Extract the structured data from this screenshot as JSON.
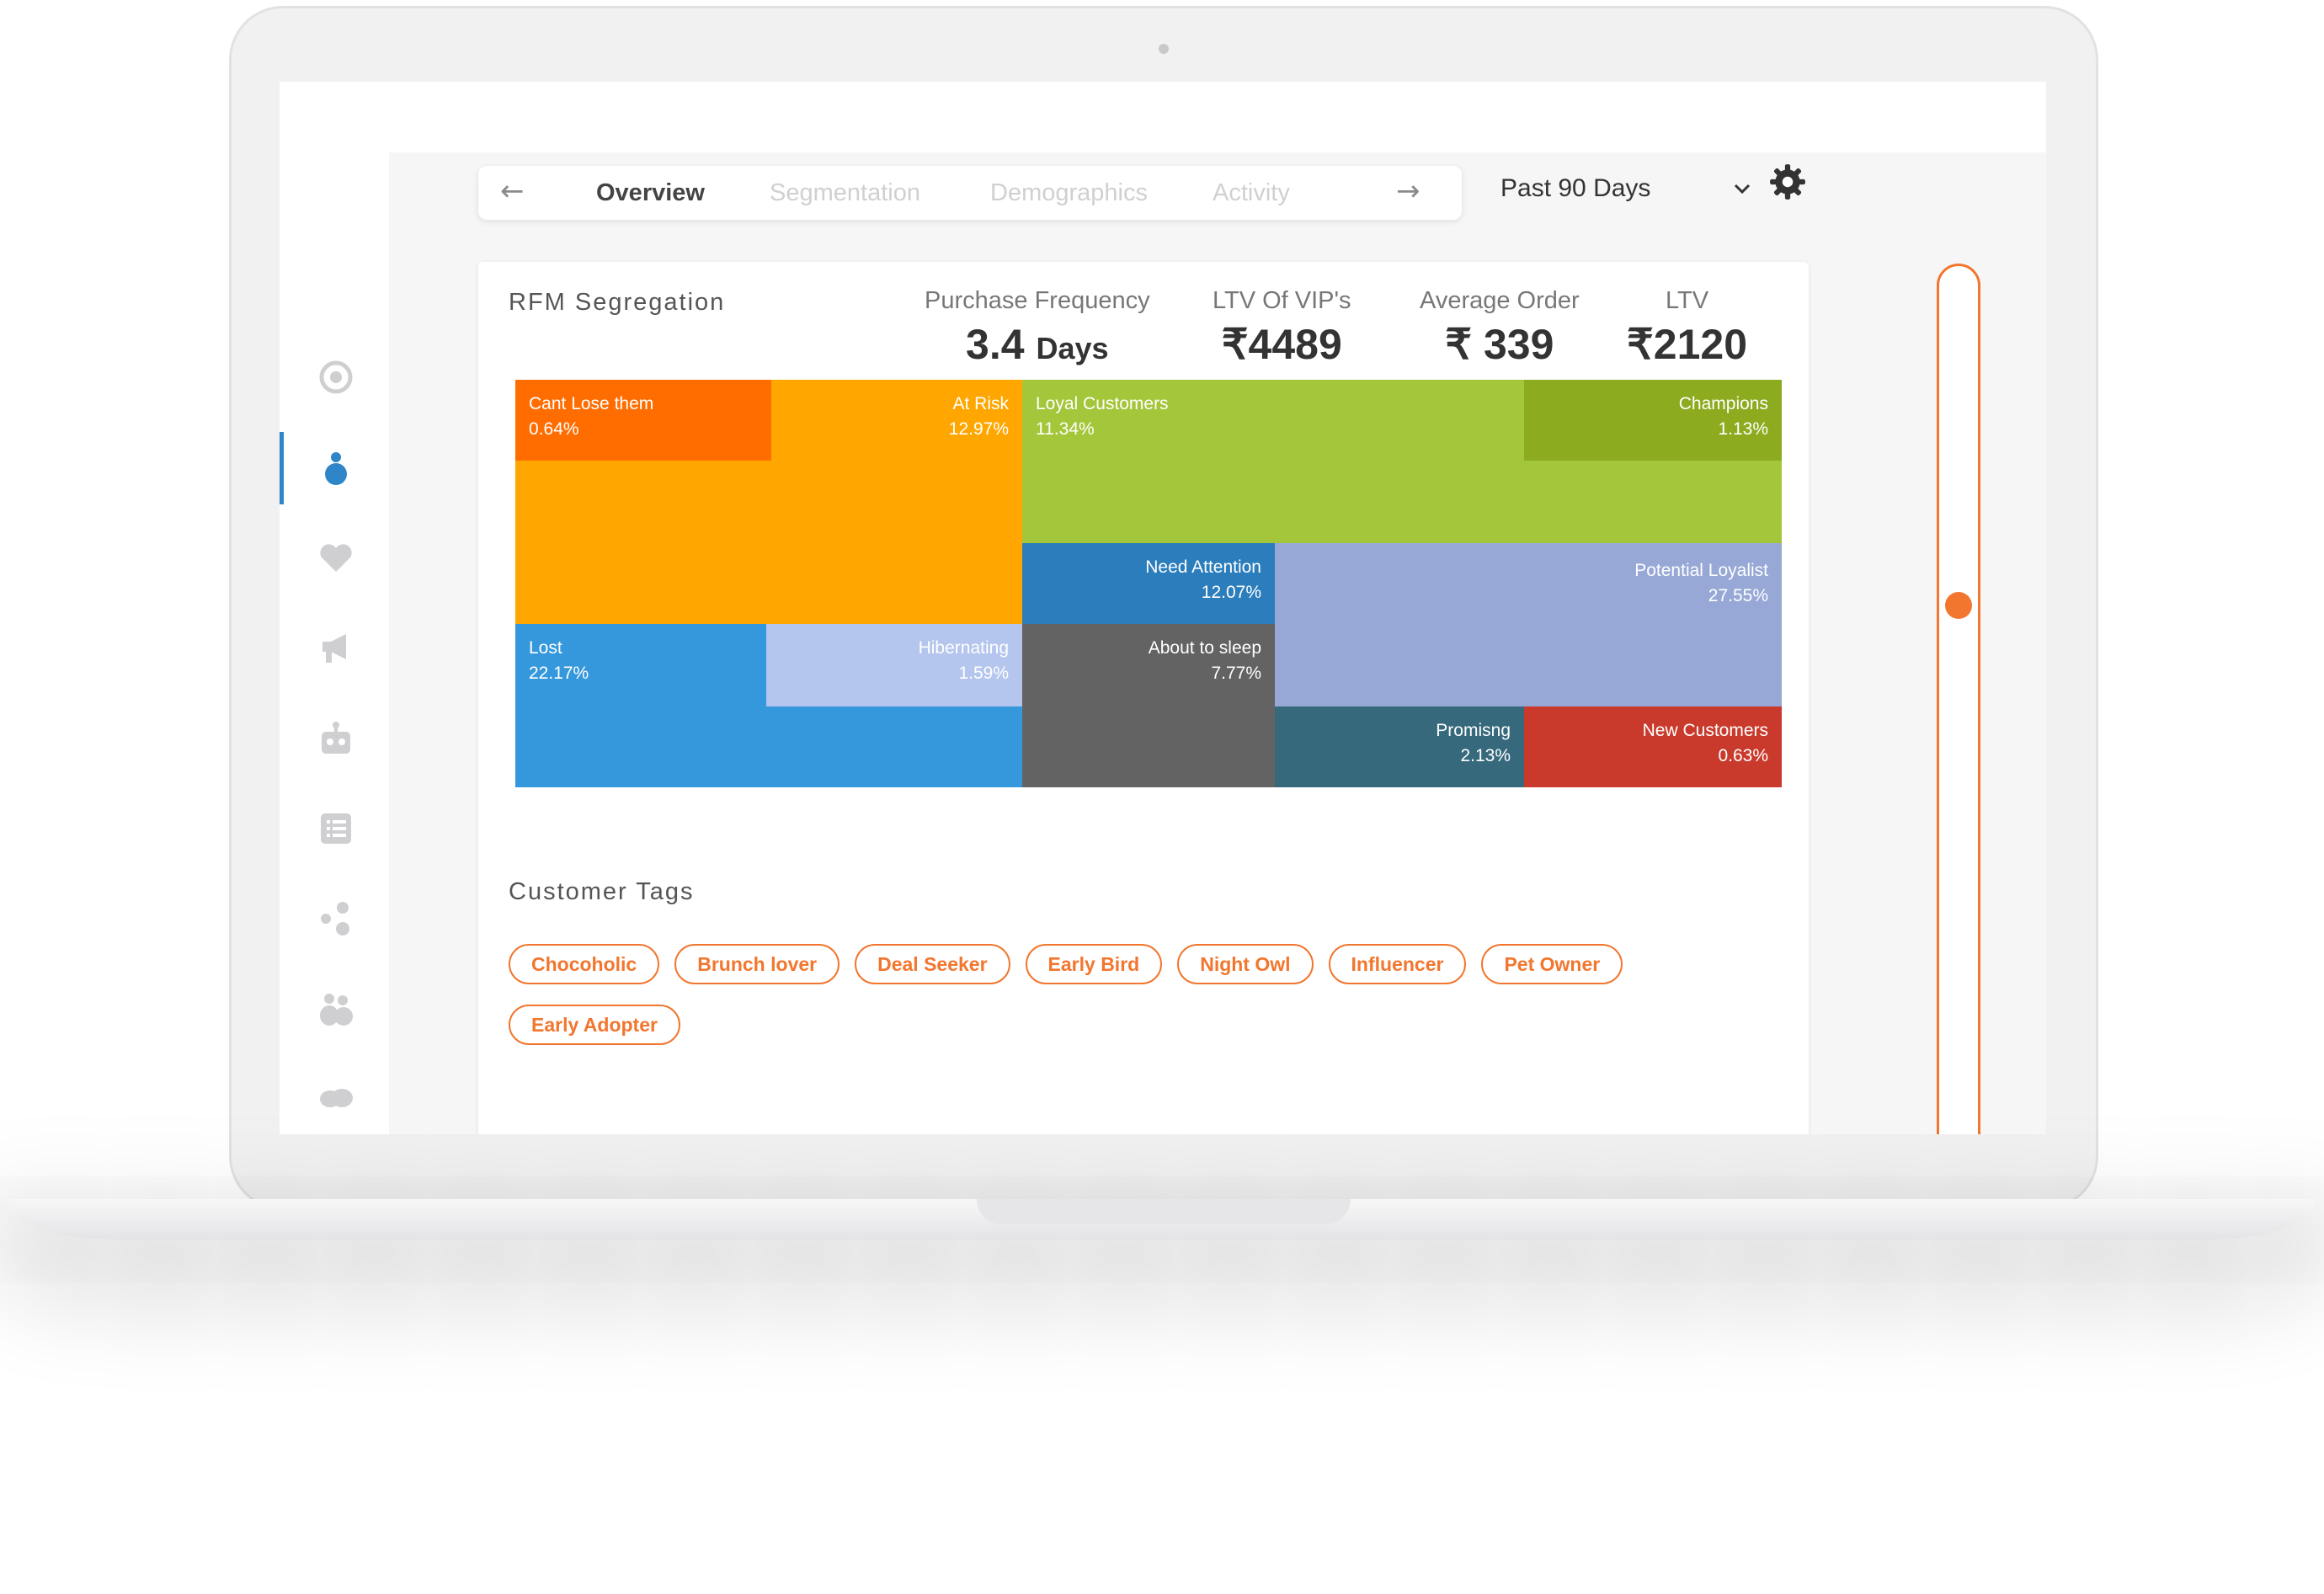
{
  "nav": {
    "tabs": [
      {
        "label": "Overview",
        "active": true
      },
      {
        "label": "Segmentation",
        "active": false
      },
      {
        "label": "Demographics",
        "active": false
      },
      {
        "label": "Activity",
        "active": false
      }
    ],
    "back_icon": "arrow-left-icon",
    "forward_icon": "arrow-right-icon",
    "period": "Past 90 Days",
    "settings_icon": "gear-icon"
  },
  "sidebar": {
    "items": [
      {
        "icon": "target-icon",
        "active": false
      },
      {
        "icon": "user-icon",
        "active": true
      },
      {
        "icon": "heart-icon",
        "active": false
      },
      {
        "icon": "megaphone-icon",
        "active": false
      },
      {
        "icon": "robot-icon",
        "active": false
      },
      {
        "icon": "list-icon",
        "active": false
      },
      {
        "icon": "network-icon",
        "active": false
      },
      {
        "icon": "users-icon",
        "active": false
      },
      {
        "icon": "chat-bubbles-icon",
        "active": false
      },
      {
        "icon": "gear-icon",
        "active": false
      }
    ],
    "active_color": "#2e86c9",
    "icon_color": "#cfcfd2"
  },
  "rfm": {
    "title": "RFM Segregation",
    "kpis": {
      "purchase_frequency": {
        "label": "Purchase Frequency",
        "value": "3.4",
        "unit": "Days"
      },
      "ltv_vip": {
        "label": "LTV Of VIP's",
        "value": "₹4489"
      },
      "average_order": {
        "label": "Average Order",
        "value": "₹ 339"
      },
      "ltv": {
        "label": "LTV",
        "value": "₹2120"
      }
    }
  },
  "chart_data": {
    "type": "treemap",
    "segments": [
      {
        "name": "Cant Lose them",
        "percent": "0.64%",
        "color": "#ff6d00"
      },
      {
        "name": "At Risk",
        "percent": "12.97%",
        "color": "#ffa700"
      },
      {
        "name": "Loyal Customers",
        "percent": "11.34%",
        "color": "#a4c63a"
      },
      {
        "name": "Champions",
        "percent": "1.13%",
        "color": "#8cab1f"
      },
      {
        "name": "Need Attention",
        "percent": "12.07%",
        "color": "#2b7dbc"
      },
      {
        "name": "Potential Loyalist",
        "percent": "27.55%",
        "color": "#97a8d6"
      },
      {
        "name": "Lost",
        "percent": "22.17%",
        "color": "#3598dc"
      },
      {
        "name": "Hibernating",
        "percent": "1.59%",
        "color": "#b4c5ee"
      },
      {
        "name": "About to sleep",
        "percent": "7.77%",
        "color": "#646364"
      },
      {
        "name": "Promisng",
        "percent": "2.13%",
        "color": "#36697c"
      },
      {
        "name": "New Customers",
        "percent": "0.63%",
        "color": "#c93a2c"
      }
    ]
  },
  "tags": {
    "title": "Customer Tags",
    "items": [
      "Chocoholic",
      "Brunch lover",
      "Deal Seeker",
      "Early Bird",
      "Night Owl",
      "Influencer",
      "Pet Owner",
      "Early Adopter"
    ],
    "color": "#f2762e"
  },
  "slider": {
    "value_fraction": 0.36,
    "color": "#f2762e"
  }
}
